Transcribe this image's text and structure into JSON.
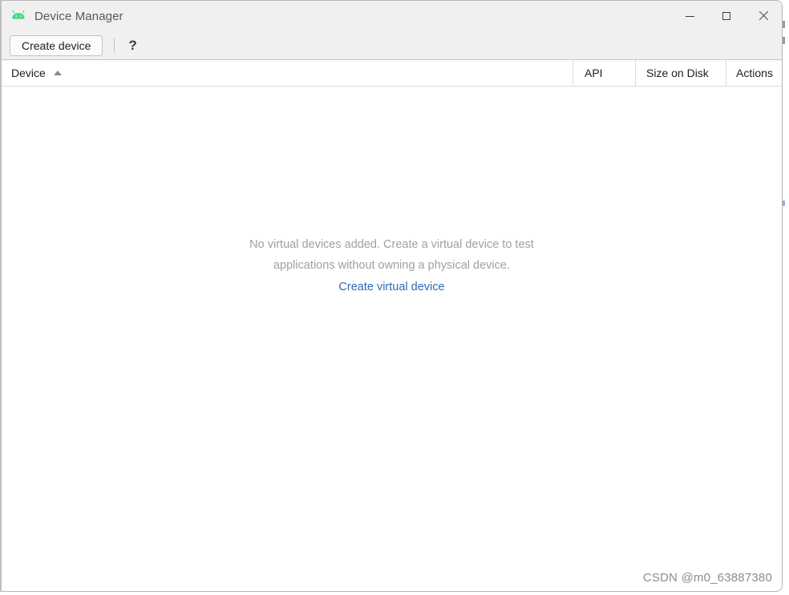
{
  "window": {
    "title": "Device Manager",
    "app_icon": "android-robot-icon",
    "accent_link_color": "#2d6ab4",
    "android_green": "#3ddc84",
    "controls": {
      "minimize_label": "–",
      "maximize_label": "□",
      "close_label": "✕"
    }
  },
  "toolbar": {
    "create_device_label": "Create device",
    "help_label": "?"
  },
  "table": {
    "columns": [
      {
        "key": "device",
        "label": "Device",
        "sort": "ascending"
      },
      {
        "key": "api",
        "label": "API",
        "sort": "none"
      },
      {
        "key": "size",
        "label": "Size on Disk",
        "sort": "none"
      },
      {
        "key": "actions",
        "label": "Actions",
        "sort": "none"
      }
    ],
    "rows": []
  },
  "empty_state": {
    "line1": "No virtual devices added. Create a virtual device to test",
    "line2": "applications without owning a physical device.",
    "link": "Create virtual device"
  },
  "watermark": {
    "text": "CSDN @m0_63887380"
  }
}
